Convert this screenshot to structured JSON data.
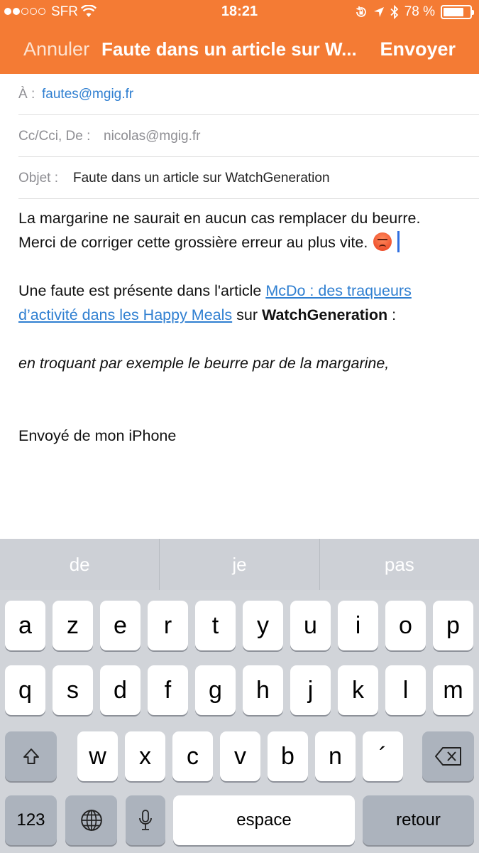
{
  "status_bar": {
    "carrier": "SFR",
    "time": "18:21",
    "battery_percent": "78 %",
    "battery_level": 0.78,
    "signal_bars_filled": 2,
    "signal_bars_total": 5
  },
  "nav": {
    "cancel": "Annuler",
    "title": "Faute dans un article sur W...",
    "send": "Envoyer"
  },
  "fields": {
    "to_label": "À :",
    "to_value": "fautes@mgig.fr",
    "cc_label": "Cc/Cci, De :",
    "cc_value": "nicolas@mgig.fr",
    "subject_label": "Objet :",
    "subject_value": "Faute dans un article sur WatchGeneration"
  },
  "body": {
    "line1": "La margarine ne saurait en aucun cas remplacer du beurre.",
    "line2": "Merci de corriger cette grossière erreur au plus vite.",
    "fault_intro": "Une faute est présente dans l'article ",
    "article_link": "McDo : des traqueurs d’activité dans les Happy Meals",
    "sur": " sur ",
    "site": "WatchGeneration",
    "colon": " :",
    "quote": "en troquant par exemple le beurre par de la margarine,",
    "signature": "Envoyé de mon iPhone"
  },
  "keyboard": {
    "suggestions": [
      "de",
      "je",
      "pas"
    ],
    "row1": [
      "a",
      "z",
      "e",
      "r",
      "t",
      "y",
      "u",
      "i",
      "o",
      "p"
    ],
    "row2": [
      "q",
      "s",
      "d",
      "f",
      "g",
      "h",
      "j",
      "k",
      "l",
      "m"
    ],
    "row3": [
      "w",
      "x",
      "c",
      "v",
      "b",
      "n",
      "´"
    ],
    "numbers": "123",
    "space": "espace",
    "return": "retour"
  },
  "colors": {
    "accent": "#f47b34",
    "link": "#2f7fd1",
    "keyboard_bg": "#d1d4d9"
  }
}
